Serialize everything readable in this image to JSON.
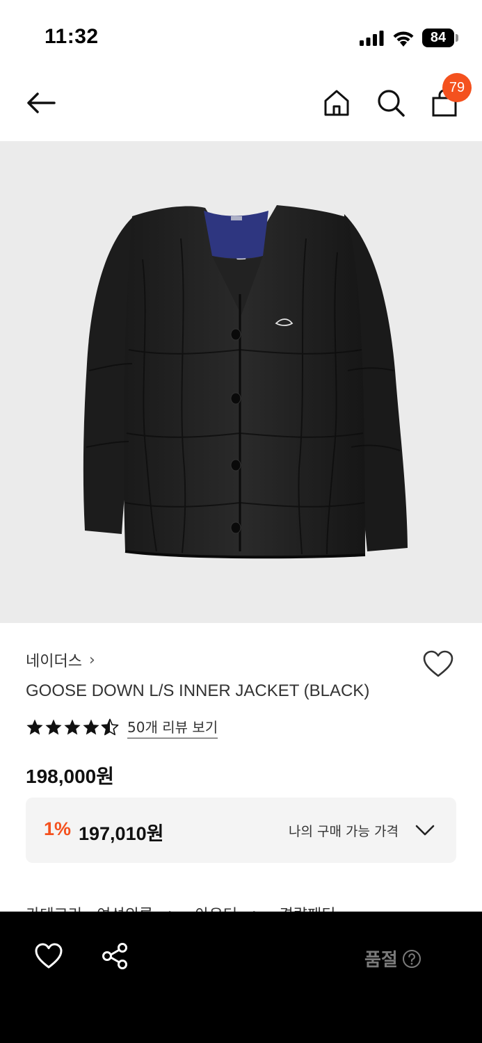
{
  "status_bar": {
    "time": "11:32",
    "battery": "84",
    "icons": [
      "signal-icon",
      "wifi-icon",
      "battery-icon"
    ]
  },
  "nav": {
    "icons": [
      "back-arrow-icon",
      "home-icon",
      "search-icon",
      "shopping-bag-icon"
    ],
    "cart_count": "79",
    "badge_color": "#f4511e"
  },
  "product": {
    "image_desc": "black-quilted-down-jacket",
    "brand": "네이더스",
    "brand_chevron": "›",
    "title": "GOOSE DOWN L/S INNER JACKET (BLACK)",
    "rating": 4.5,
    "rating_max": 5,
    "review_link": "50개 리뷰 보기",
    "price": "198,000원",
    "discount": {
      "rate": "1%",
      "price": "197,010원",
      "label": "나의 구매 가능 가격",
      "rate_color": "#f4511e"
    },
    "category": {
      "label": "카테고리",
      "path": [
        "여성의류",
        ">",
        "아우터",
        ">",
        "경량패딩"
      ]
    }
  },
  "bottom_bar": {
    "icons": [
      "heart-icon",
      "share-icon",
      "help-circle-icon"
    ],
    "soldout_label": "품절"
  }
}
